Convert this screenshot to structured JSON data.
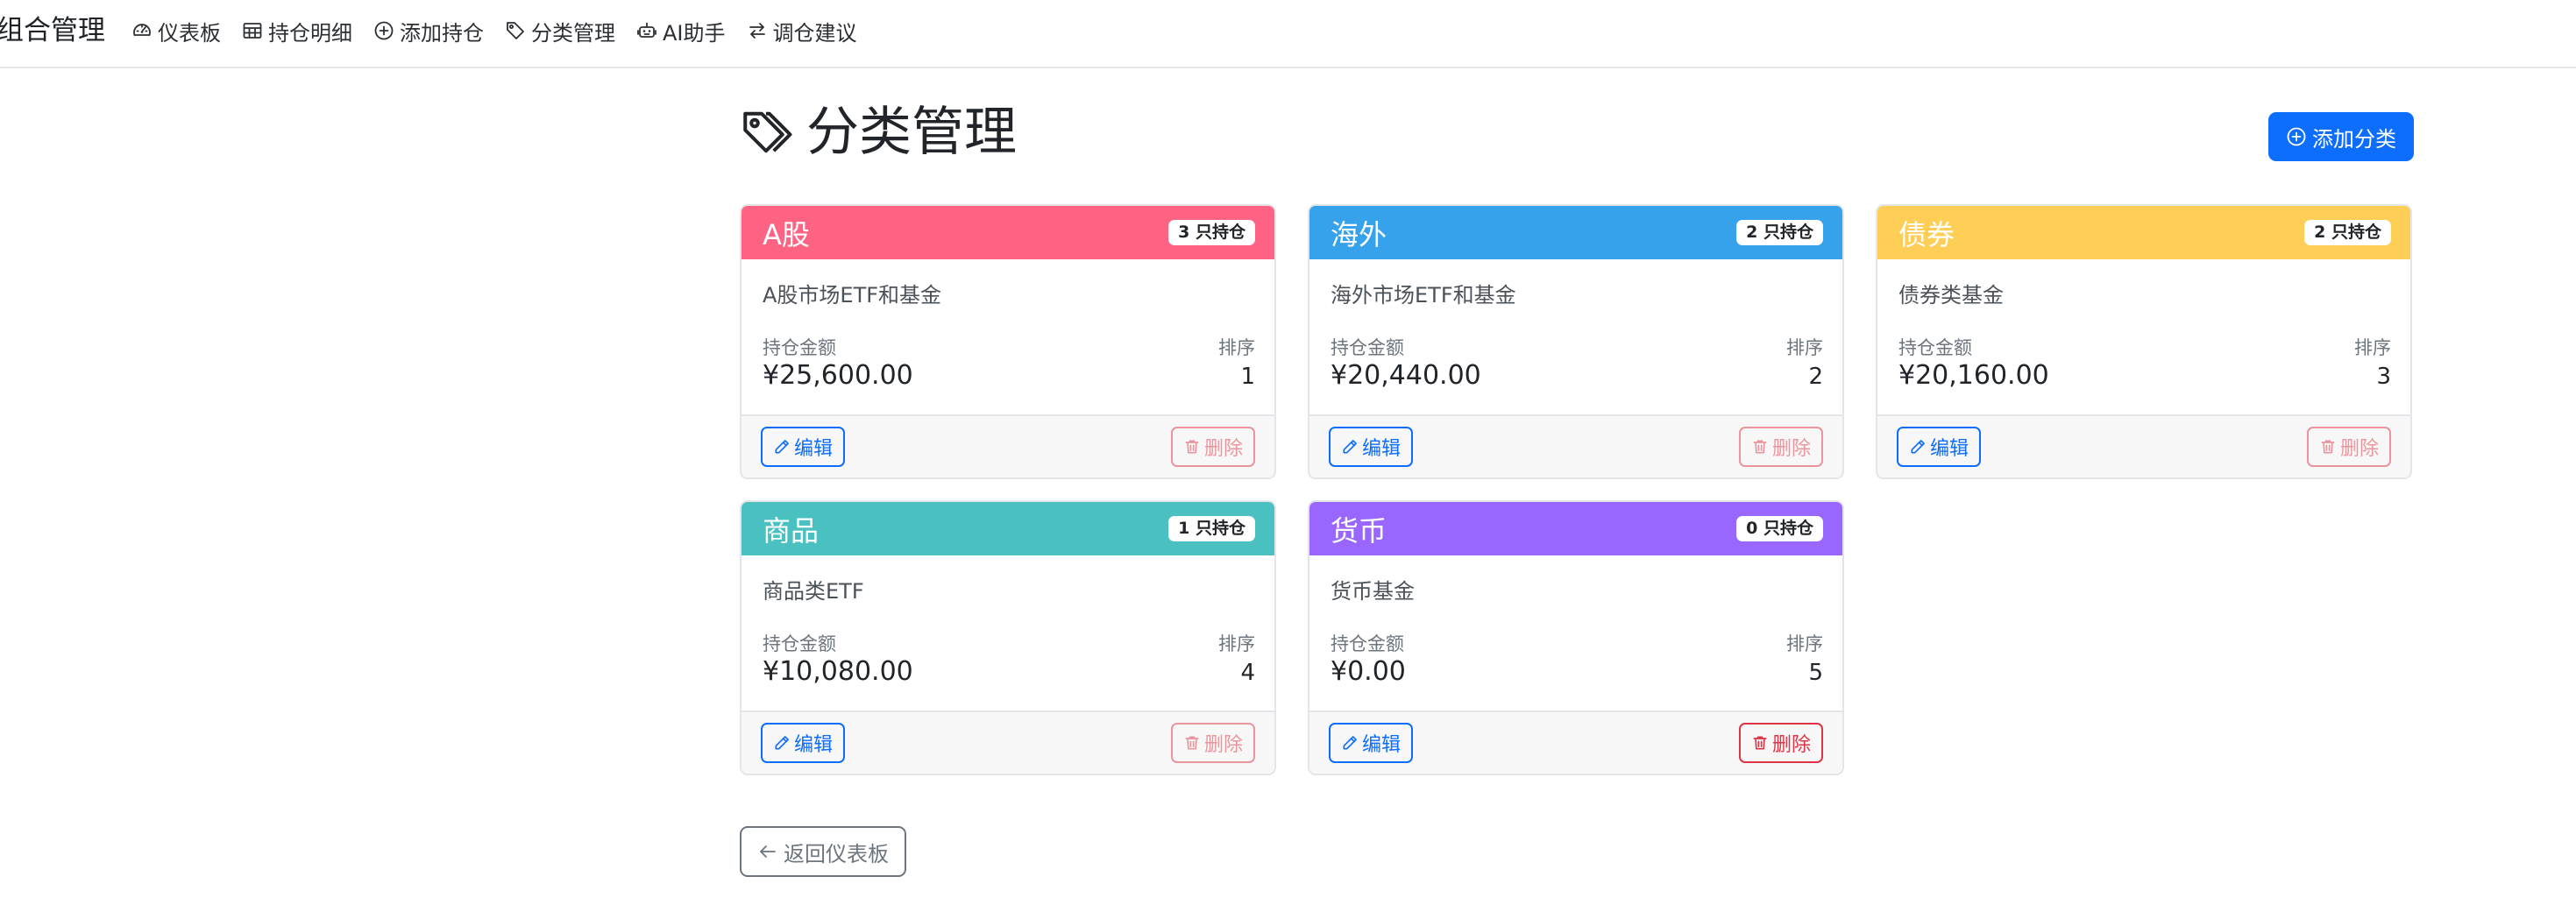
{
  "navbar": {
    "brand": "组合管理",
    "items": [
      {
        "label": "仪表板",
        "icon": "speedometer-icon"
      },
      {
        "label": "持仓明细",
        "icon": "table-icon"
      },
      {
        "label": "添加持仓",
        "icon": "plus-circle-icon"
      },
      {
        "label": "分类管理",
        "icon": "tags-icon"
      },
      {
        "label": "AI助手",
        "icon": "robot-icon"
      },
      {
        "label": "调仓建议",
        "icon": "arrow-left-right-icon"
      }
    ]
  },
  "page": {
    "title": "分类管理",
    "add_button": "添加分类",
    "back_button": "返回仪表板"
  },
  "labels": {
    "amount": "持仓金额",
    "sort": "排序",
    "edit": "编辑",
    "delete": "删除"
  },
  "categories": [
    {
      "name": "A股",
      "count_badge": "3 只持仓",
      "description": "A股市场ETF和基金",
      "amount": "¥25,600.00",
      "sort": "1",
      "color": "#ff6384",
      "delete_enabled": false
    },
    {
      "name": "海外",
      "count_badge": "2 只持仓",
      "description": "海外市场ETF和基金",
      "amount": "¥20,440.00",
      "sort": "2",
      "color": "#36a2eb",
      "delete_enabled": false
    },
    {
      "name": "债券",
      "count_badge": "2 只持仓",
      "description": "债券类基金",
      "amount": "¥20,160.00",
      "sort": "3",
      "color": "#ffce56",
      "delete_enabled": false
    },
    {
      "name": "商品",
      "count_badge": "1 只持仓",
      "description": "商品类ETF",
      "amount": "¥10,080.00",
      "sort": "4",
      "color": "#4bc0c0",
      "delete_enabled": false
    },
    {
      "name": "货币",
      "count_badge": "0 只持仓",
      "description": "货币基金",
      "amount": "¥0.00",
      "sort": "5",
      "color": "#9966ff",
      "delete_enabled": true
    }
  ],
  "colors": {
    "primary": "#0d6efd",
    "danger": "#dc3545",
    "secondary": "#6c757d"
  }
}
